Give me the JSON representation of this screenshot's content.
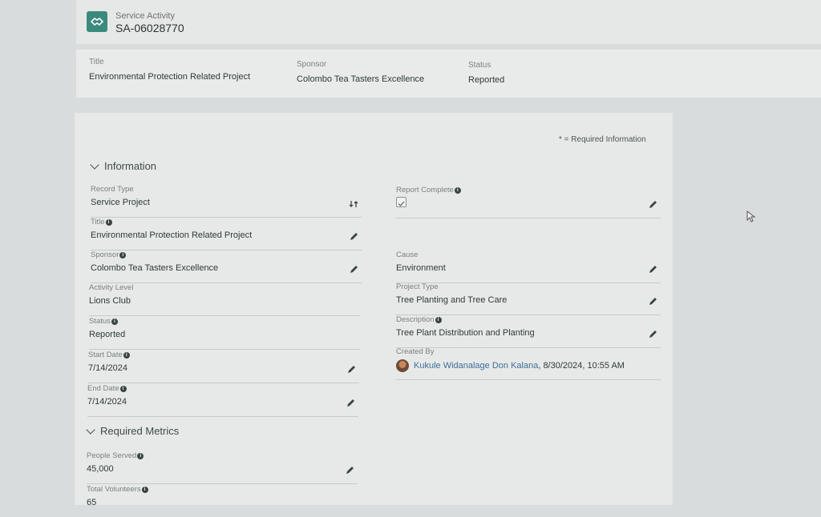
{
  "header": {
    "object_label": "Service Activity",
    "record_name": "SA-06028770",
    "icon": "handshake-icon",
    "icon_color": "#3b8a7e"
  },
  "highlights": {
    "title_label": "Title",
    "title_value": "Environmental Protection Related Project",
    "sponsor_label": "Sponsor",
    "sponsor_value": "Colombo Tea Tasters Excellence",
    "status_label": "Status",
    "status_value": "Reported"
  },
  "required_note": "* = Required Information",
  "sections": {
    "information": "Information",
    "required_metrics": "Required Metrics"
  },
  "fields": {
    "record_type": {
      "label": "Record Type",
      "value": "Service Project"
    },
    "title": {
      "label": "Title",
      "value": "Environmental Protection Related Project"
    },
    "sponsor": {
      "label": "Sponsor",
      "value": "Colombo Tea Tasters Excellence"
    },
    "activity_level": {
      "label": "Activity Level",
      "value": "Lions Club"
    },
    "status": {
      "label": "Status",
      "value": "Reported"
    },
    "start_date": {
      "label": "Start Date",
      "value": "7/14/2024"
    },
    "end_date": {
      "label": "End Date",
      "value": "7/14/2024"
    },
    "report_complete": {
      "label": "Report Complete",
      "checked": true
    },
    "cause": {
      "label": "Cause",
      "value": "Environment"
    },
    "project_type": {
      "label": "Project Type",
      "value": "Tree Planting and Tree Care"
    },
    "description": {
      "label": "Description",
      "value": "Tree Plant Distribution and Planting"
    },
    "created_by": {
      "label": "Created By",
      "user": "Kukule Widanalage Don Kalana",
      "timestamp": ", 8/30/2024, 10:55 AM"
    },
    "people_served": {
      "label": "People Served",
      "value": "45,000"
    },
    "total_volunteers": {
      "label": "Total Volunteers",
      "value": "65"
    }
  },
  "colors": {
    "link": "#3d6f9a",
    "background": "#d9dcdc",
    "card": "#e7e9e8"
  }
}
